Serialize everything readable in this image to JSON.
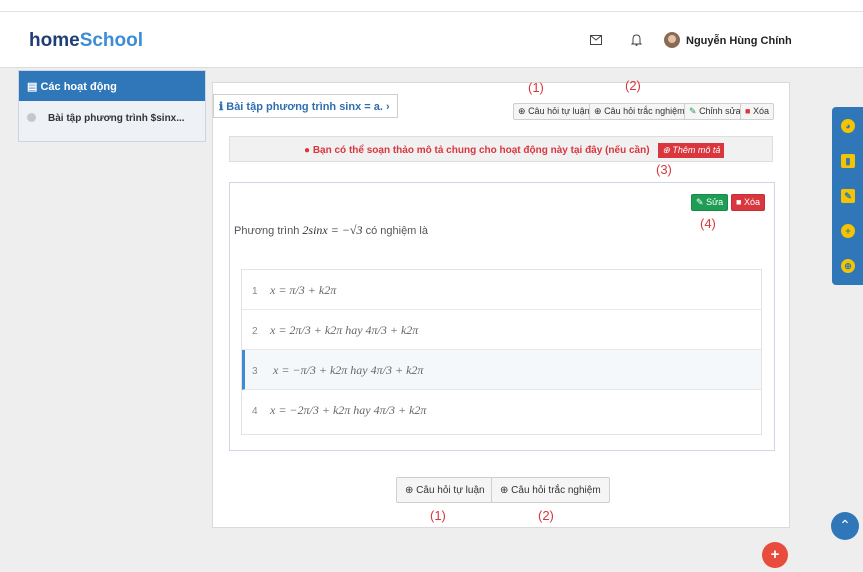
{
  "header": {
    "logo_home": "home",
    "logo_school": "School",
    "mail_icon": "envelope-icon",
    "bell_icon": "bell-icon",
    "username": "Nguyễn Hùng Chính"
  },
  "sidebar": {
    "title": "Các hoạt động",
    "items": [
      {
        "label": "Bài tập phương trình $sinx..."
      }
    ]
  },
  "main": {
    "breadcrumb": "Bài tập phương trình sinx = a.",
    "toolbar": {
      "essay_label": "Câu hỏi tự luận",
      "mc_label": "Câu hỏi trắc nghiệm",
      "edit_label": "Chỉnh sửa",
      "delete_label": "Xóa"
    },
    "note": {
      "text": "Bạn có thể soạn thảo mô tả chung cho hoạt động này tại đây (nếu cần)",
      "add_label": "Thêm mô tả"
    },
    "question": {
      "edit_label": "Sửa",
      "delete_label": "Xóa",
      "prefix": "Phương trình",
      "equation": "2sinx = −√3",
      "suffix": "có nghiệm là",
      "answers": [
        {
          "num": "1",
          "text": "x = π/3 + k2π"
        },
        {
          "num": "2",
          "text": "x = 2π/3 + k2π hay 4π/3 + k2π"
        },
        {
          "num": "3",
          "text": "x = −π/3 + k2π hay 4π/3 + k2π",
          "selected": true
        },
        {
          "num": "4",
          "text": "x = −2π/3 + k2π hay 4π/3 + k2π"
        }
      ]
    },
    "bottom": {
      "essay_label": "Câu hỏi tự luận",
      "mc_label": "Câu hỏi trắc nghiệm"
    }
  },
  "annotations": {
    "a1": "(1)",
    "a2": "(2)",
    "a3": "(3)",
    "a4": "(4)",
    "b1": "(1)",
    "b2": "(2)"
  },
  "colors": {
    "primary": "#2f77b9",
    "danger": "#d9363e",
    "success": "#1f9d55",
    "accent": "#f5c400"
  }
}
